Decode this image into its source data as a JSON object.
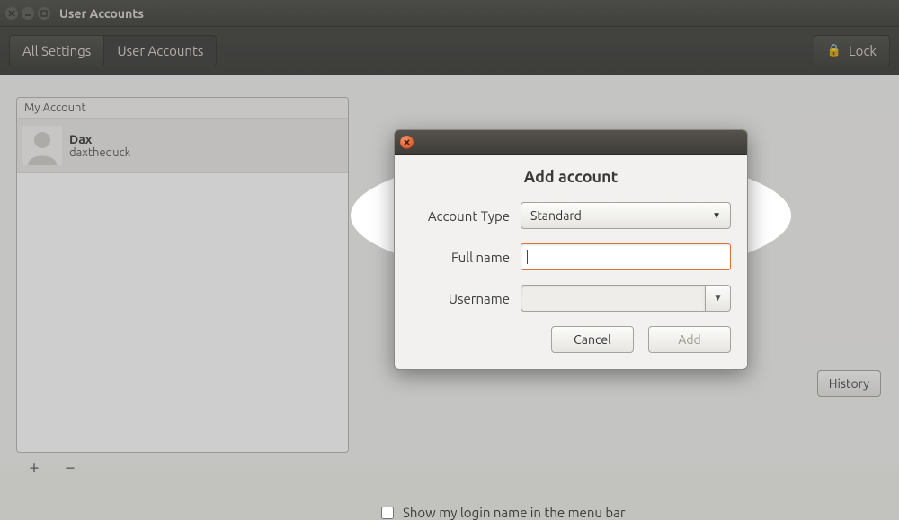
{
  "window": {
    "title": "User Accounts"
  },
  "toolbar": {
    "all_settings": "All Settings",
    "user_accounts": "User Accounts",
    "lock_label": "Lock"
  },
  "sidebar": {
    "section_label": "My Account",
    "account": {
      "display_name": "Dax",
      "username": "daxtheduck"
    },
    "add_tooltip": "+",
    "remove_tooltip": "−"
  },
  "content": {
    "history_button": "History",
    "login_name_checkbox": "Show my login name in the menu bar",
    "login_name_checked": false
  },
  "dialog": {
    "title": "Add account",
    "fields": {
      "account_type_label": "Account Type",
      "account_type_value": "Standard",
      "full_name_label": "Full name",
      "full_name_value": "",
      "username_label": "Username",
      "username_value": ""
    },
    "buttons": {
      "cancel": "Cancel",
      "add": "Add"
    }
  }
}
